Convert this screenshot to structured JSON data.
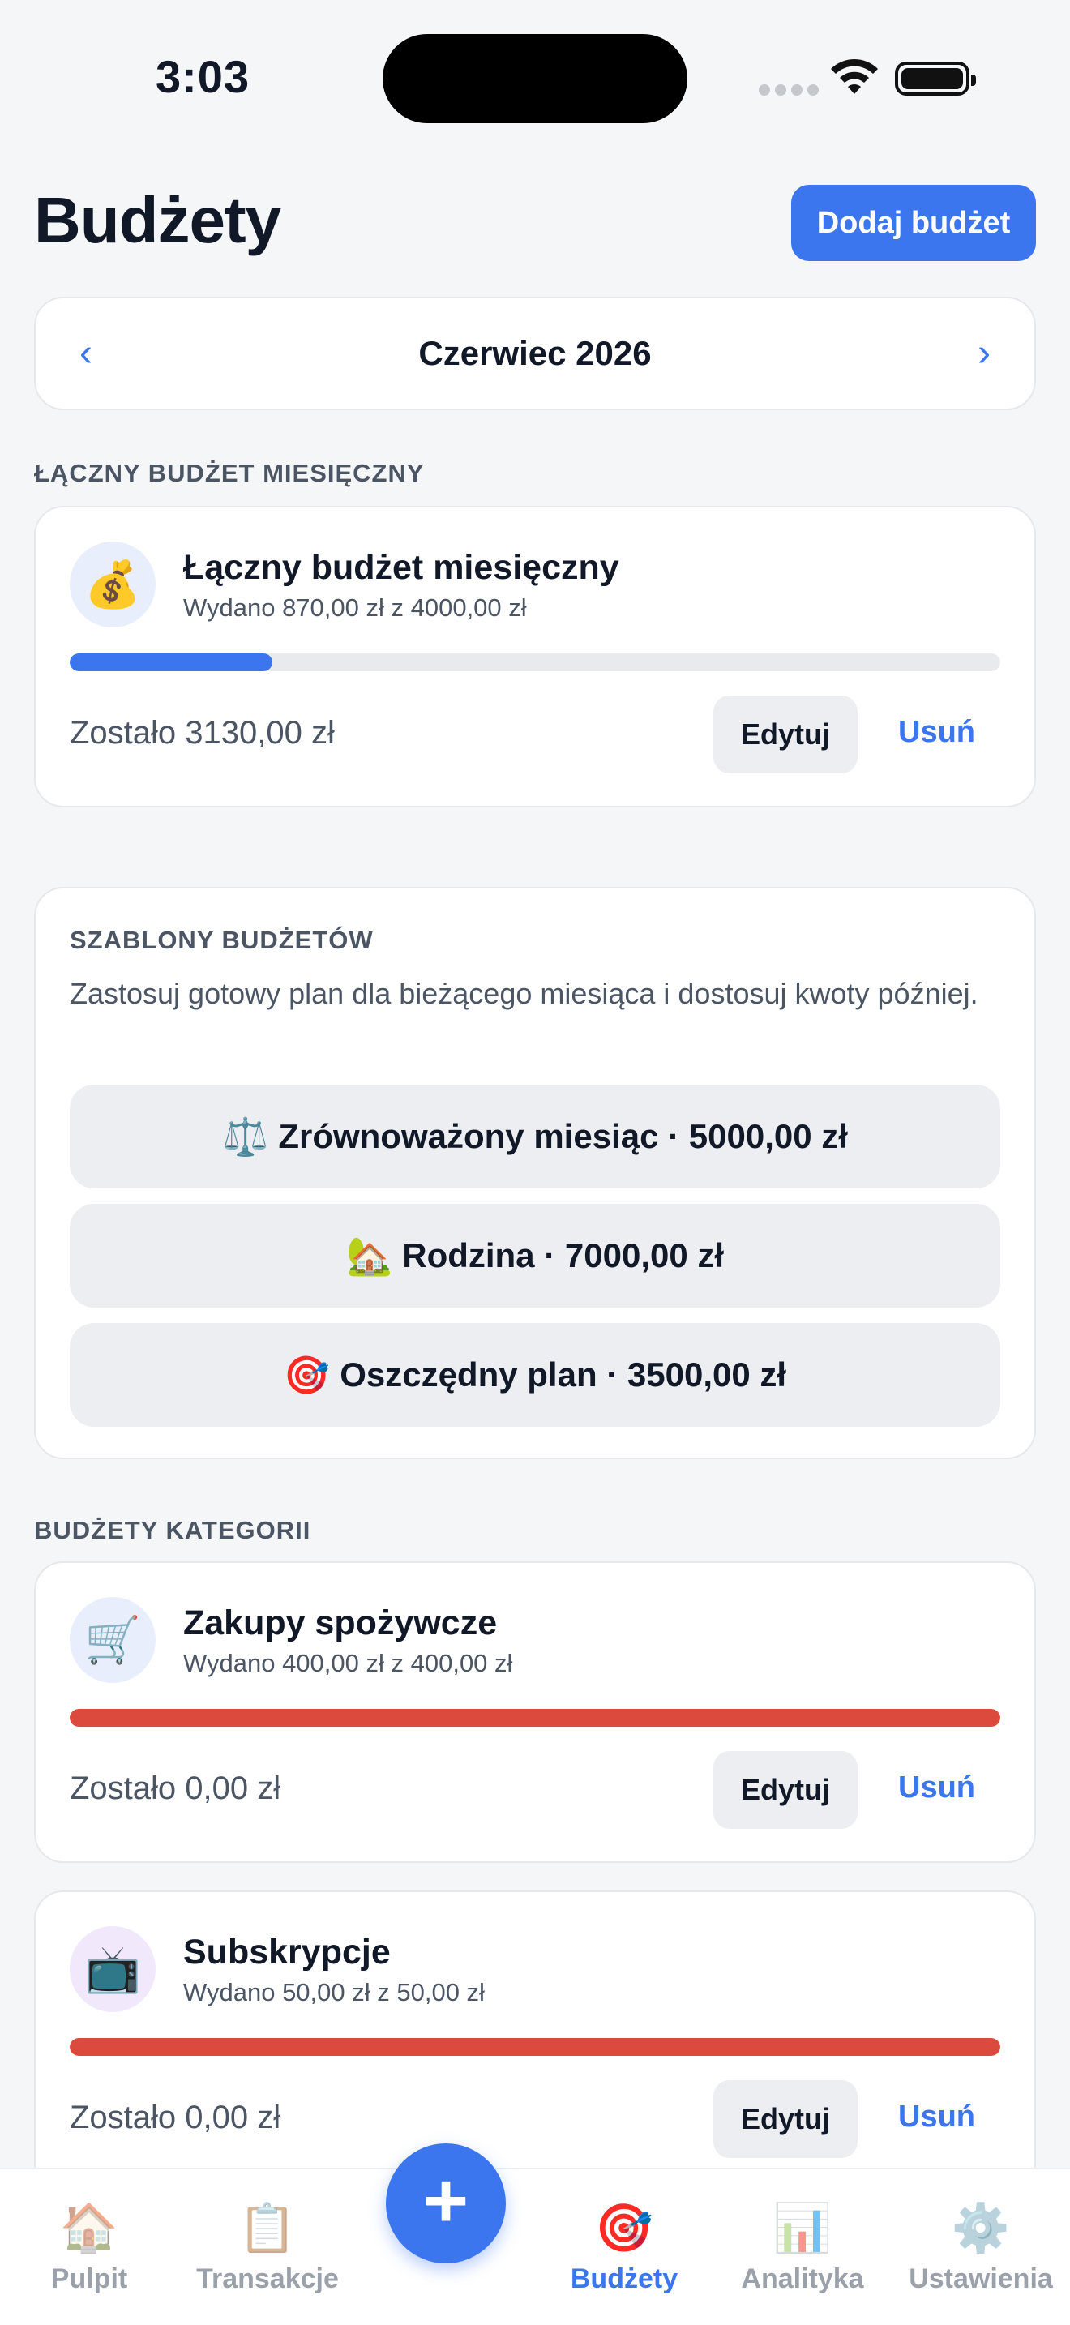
{
  "status": {
    "time": "3:03"
  },
  "header": {
    "title": "Budżety",
    "add_button": "Dodaj budżet"
  },
  "month": {
    "prev": "‹",
    "label": "Czerwiec 2026",
    "next": "›"
  },
  "total_section": {
    "label": "ŁĄCZNY BUDŻET MIESIĘCZNY",
    "card": {
      "icon": "💰",
      "icon_name": "money-bag-icon",
      "title": "Łączny budżet miesięczny",
      "subtitle": "Wydano 870,00 zł z 4000,00 zł",
      "progress": 0.2175,
      "bar_color": "#3b76ef",
      "remaining": "Zostało 3130,00 zł",
      "edit": "Edytuj",
      "delete": "Usuń"
    }
  },
  "templates": {
    "label": "SZABLONY BUDŻETÓW",
    "description": "Zastosuj gotowy plan dla bieżącego miesiąca i dostosuj kwoty później.",
    "items": [
      {
        "emoji": "⚖️",
        "label": "Zrównoważony miesiąc · 5000,00 zł"
      },
      {
        "emoji": "🏡",
        "label": "Rodzina · 7000,00 zł"
      },
      {
        "emoji": "🎯",
        "label": "Oszczędny plan · 3500,00 zł"
      }
    ]
  },
  "categories_section": {
    "label": "BUDŻETY KATEGORII",
    "items": [
      {
        "icon": "🛒",
        "icon_name": "shopping-cart-icon",
        "avatar_bg": "#e8eefb",
        "title": "Zakupy spożywcze",
        "subtitle": "Wydano 400,00 zł z 400,00 zł",
        "progress": 1.0,
        "bar_color": "#dc4a3d",
        "remaining": "Zostało 0,00 zł",
        "edit": "Edytuj",
        "delete": "Usuń"
      },
      {
        "icon": "📺",
        "icon_name": "tv-icon",
        "avatar_bg": "#f1e8fb",
        "title": "Subskrypcje",
        "subtitle": "Wydano 50,00 zł z 50,00 zł",
        "progress": 1.0,
        "bar_color": "#dc4a3d",
        "remaining": "Zostało 0,00 zł",
        "edit": "Edytuj",
        "delete": "Usuń"
      }
    ]
  },
  "tabs": [
    {
      "icon": "🏠",
      "label": "Pulpit",
      "active": false
    },
    {
      "icon": "📋",
      "label": "Transakcje",
      "active": false
    },
    {
      "icon": "🎯",
      "label": "Budżety",
      "active": true
    },
    {
      "icon": "📊",
      "label": "Analityka",
      "active": false
    },
    {
      "icon": "⚙️",
      "label": "Ustawienia",
      "active": false
    }
  ],
  "fab": {
    "symbol": "+"
  },
  "colors": {
    "accent": "#3b76ef",
    "danger": "#dc4a3d",
    "background": "#f5f6f8"
  }
}
